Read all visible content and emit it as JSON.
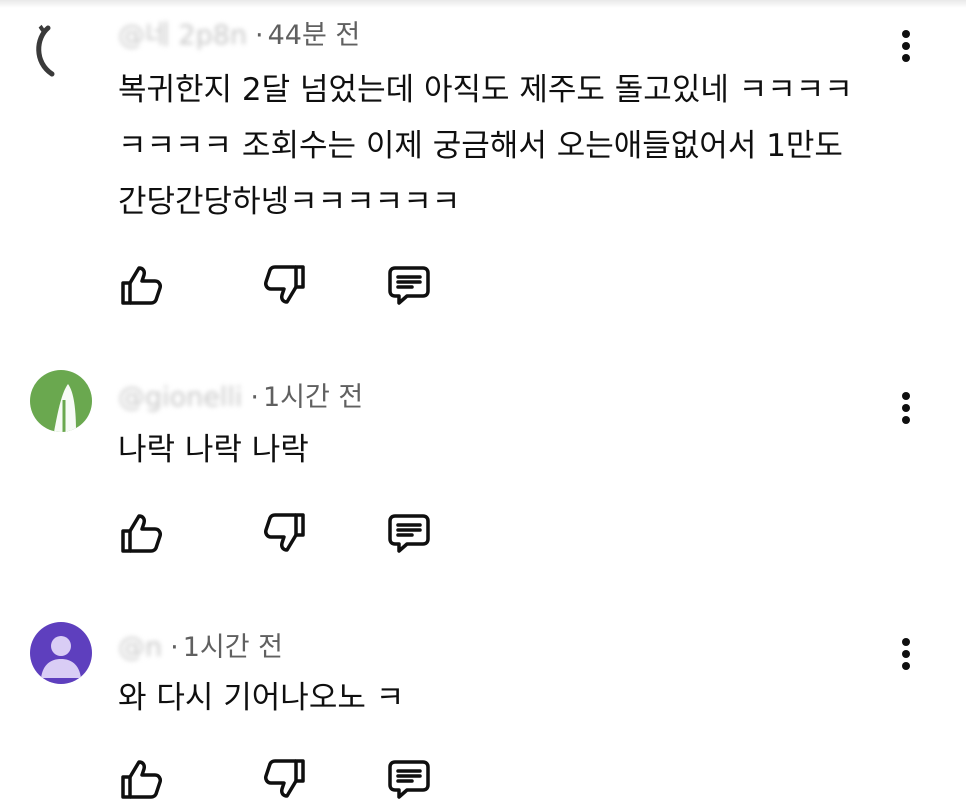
{
  "comments": [
    {
      "author": "@네 2p8n",
      "time": "44분 전",
      "separator": "·",
      "text": "복귀한지 2달 넘었는데 아직도 제주도 돌고있네 ㅋㅋㅋㅋ\nㅋㅋㅋㅋ 조회수는 이제 궁금해서 오는애들없어서 1만도\n간당간당하넹ㅋㅋㅋㅋㅋㅋ",
      "avatar_color": "#3a3a3a"
    },
    {
      "author": "@gionelli",
      "time": "1시간 전",
      "separator": "·",
      "text": "나락 나락 나락",
      "avatar_color": "#6aa84f"
    },
    {
      "author": "@n",
      "time": "1시간 전",
      "separator": "·",
      "text": "와 다시 기어나오노 ㅋ",
      "avatar_color": "#5e3fbe"
    }
  ],
  "icons": {
    "like": "thumbs-up-icon",
    "dislike": "thumbs-down-icon",
    "reply": "reply-icon",
    "more": "more-vertical-icon"
  }
}
